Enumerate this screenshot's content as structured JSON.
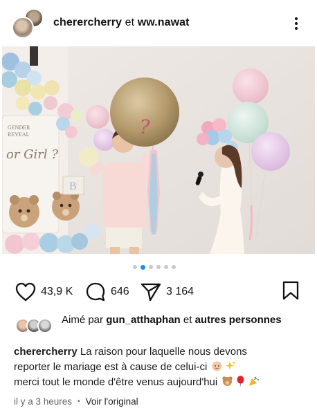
{
  "header": {
    "user1": "cherercherry",
    "connector": "et",
    "user2": "ww.nawat"
  },
  "photo": {
    "balloon_text": "?",
    "backdrop_line1": "GENDER",
    "backdrop_line2": "REVEAL",
    "backdrop_script": "or Girl ?",
    "block_letter": "B"
  },
  "carousel": {
    "count": 6,
    "active_index": 1
  },
  "actions": {
    "likes_count": "43,9 K",
    "comments_count": "646",
    "shares_count": "3 164"
  },
  "likes": {
    "prefix": "Aimé par",
    "user": "gun_atthaphan",
    "connector": "et",
    "others": "autres personnes"
  },
  "caption": {
    "author": "cherercherry",
    "line1": "La raison pour laquelle nous devons",
    "line2": "reporter le mariage est à cause de celui-ci",
    "line3": "merci tout le monde d'être venus aujourd'hui"
  },
  "footer": {
    "time": "il y a 3 heures",
    "separator": "•",
    "translate": "Voir l'original"
  },
  "colors": {
    "accent": "#1d8cf0",
    "text": "#111111",
    "muted": "#666666"
  }
}
